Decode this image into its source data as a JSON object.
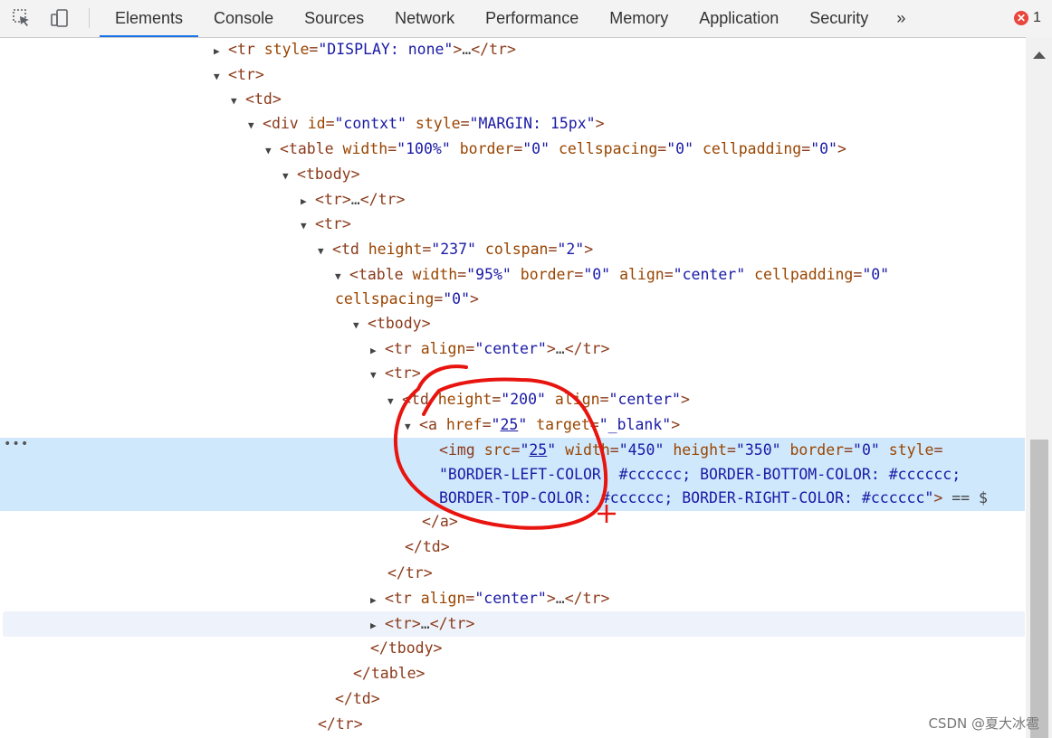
{
  "toolbar": {
    "tabs": [
      {
        "label": "Elements",
        "active": true
      },
      {
        "label": "Console"
      },
      {
        "label": "Sources"
      },
      {
        "label": "Network"
      },
      {
        "label": "Performance"
      },
      {
        "label": "Memory"
      },
      {
        "label": "Application"
      },
      {
        "label": "Security"
      }
    ],
    "more_label": "»",
    "error_count": "1",
    "icons": [
      "inspect-icon",
      "device-toggle-icon",
      "error-icon"
    ]
  },
  "tree": {
    "l1": {
      "tag": "tr",
      "attr1": "style",
      "val1": "\"DISPLAY: none\"",
      "ellipsis": "…",
      "close": "tr"
    },
    "l2": {
      "tag": "tr"
    },
    "l3": {
      "tag": "td"
    },
    "l4": {
      "tag": "div",
      "a1": "id",
      "v1": "\"contxt\"",
      "a2": "style",
      "v2": "\"MARGIN: 15px\""
    },
    "l5": {
      "tag": "table",
      "a1": "width",
      "v1": "\"100%\"",
      "a2": "border",
      "v2": "\"0\"",
      "a3": "cellspacing",
      "v3": "\"0\"",
      "a4": "cellpadding",
      "v4": "\"0\""
    },
    "l6": {
      "tag": "tbody"
    },
    "l7": {
      "tag": "tr",
      "ellipsis": "…",
      "close": "tr"
    },
    "l8": {
      "tag": "tr"
    },
    "l9": {
      "tag": "td",
      "a1": "height",
      "v1": "\"237\"",
      "a2": "colspan",
      "v2": "\"2\""
    },
    "l10": {
      "tag": "table",
      "a1": "width",
      "v1": "\"95%\"",
      "a2": "border",
      "v2": "\"0\"",
      "a3": "align",
      "v3": "\"center\"",
      "a4": "cellpadding",
      "v4": "\"0\""
    },
    "l11": {
      "a1": "cellspacing",
      "v1": "\"0\""
    },
    "l12": {
      "tag": "tbody"
    },
    "l13": {
      "tag": "tr",
      "a1": "align",
      "v1": "\"center\"",
      "ellipsis": "…",
      "close": "tr"
    },
    "l14": {
      "tag": "tr"
    },
    "l15": {
      "tag": "td",
      "a1": "height",
      "v1": "\"200\"",
      "a2": "align",
      "v2": "\"center\""
    },
    "l16": {
      "tag": "a",
      "a1": "href",
      "v1q1": "\"",
      "v1": "25",
      "v1q2": "\"",
      "a2": "target",
      "v2": "\"_blank\""
    },
    "l17": {
      "tag": "img",
      "a1": "src",
      "v1": "25",
      "a2": "width",
      "v2": "\"450\"",
      "a3": "height",
      "v3": "\"350\"",
      "a4": "border",
      "v4": "\"0\"",
      "a5": "style"
    },
    "l18": {
      "text": "\"BORDER-LEFT-COLOR: #cccccc; BORDER-BOTTOM-COLOR: #cccccc;"
    },
    "l19": {
      "text": "BORDER-TOP-COLOR: #cccccc; BORDER-RIGHT-COLOR: #cccccc\"",
      "suffix": " == $"
    },
    "l20": {
      "close": "a"
    },
    "l21": {
      "close": "td"
    },
    "l22": {
      "close": "tr"
    },
    "l23": {
      "tag": "tr",
      "a1": "align",
      "v1": "\"center\"",
      "ellipsis": "…",
      "close": "tr"
    },
    "l24": {
      "tag": "tr",
      "ellipsis": "…",
      "close": "tr"
    },
    "l25": {
      "close": "tbody"
    },
    "l26": {
      "close": "table"
    },
    "l27": {
      "close": "td"
    },
    "l28": {
      "close": "tr"
    },
    "gutter": "•••"
  },
  "watermark": "CSDN @夏大冰雹",
  "colors": {
    "annotation": "#e8140f",
    "selected_row": "#cfe8fc",
    "active_tab": "#1a73e8"
  }
}
